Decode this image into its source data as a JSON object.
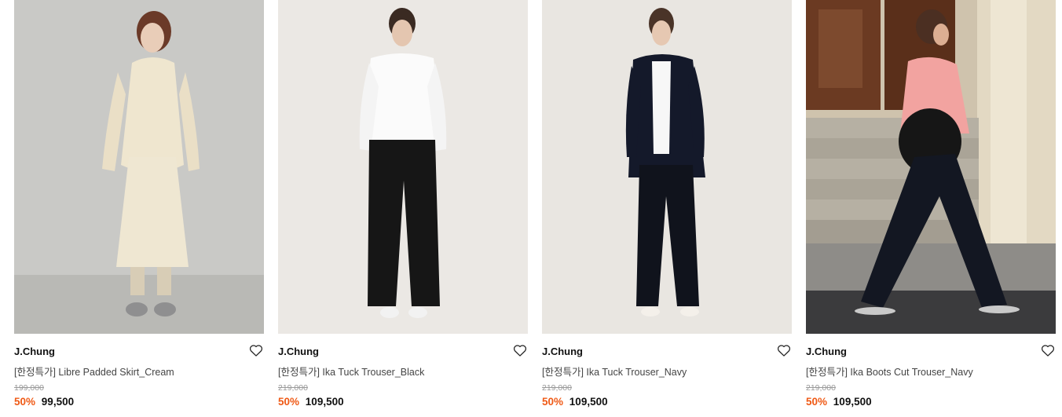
{
  "products": [
    {
      "brand": "J.Chung",
      "name": "[한정특가] Libre Padded Skirt_Cream",
      "original_price": "199,000",
      "discount": "50%",
      "sale_price": "99,500",
      "wishlist_icon": "heart-outline-icon"
    },
    {
      "brand": "J.Chung",
      "name": "[한정특가] Ika Tuck Trouser_Black",
      "original_price": "219,000",
      "discount": "50%",
      "sale_price": "109,500",
      "wishlist_icon": "heart-outline-icon"
    },
    {
      "brand": "J.Chung",
      "name": "[한정특가] Ika Tuck Trouser_Navy",
      "original_price": "219,000",
      "discount": "50%",
      "sale_price": "109,500",
      "wishlist_icon": "heart-outline-icon"
    },
    {
      "brand": "J.Chung",
      "name": "[한정특가] Ika Boots Cut Trouser_Navy",
      "original_price": "219,000",
      "discount": "50%",
      "sale_price": "109,500",
      "wishlist_icon": "heart-outline-icon"
    }
  ],
  "colors": {
    "discount": "#ef5a16",
    "original_price": "#9a9a9a",
    "brand": "#111111"
  }
}
